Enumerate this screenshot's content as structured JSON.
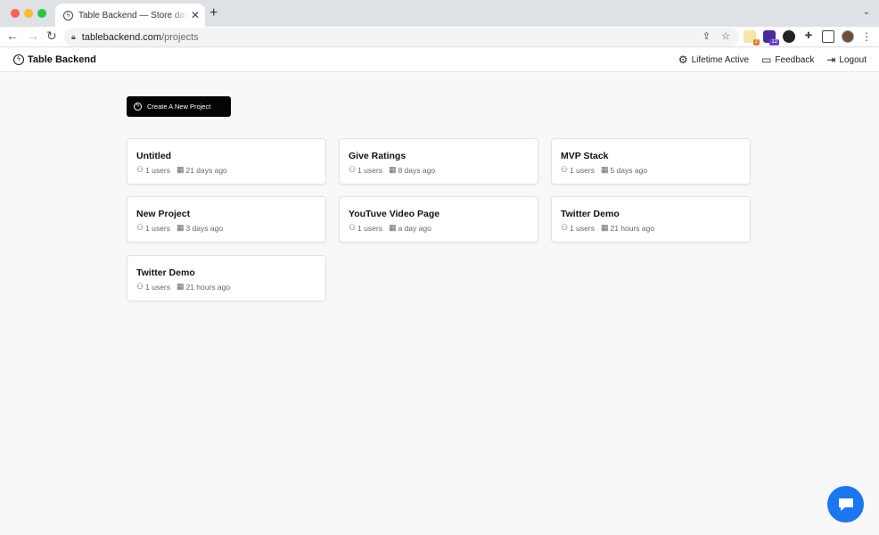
{
  "browser": {
    "tab_title": "Table Backend — Store data in tables",
    "tab_close": "✕",
    "new_tab": "+",
    "url_host": "tablebackend.com",
    "url_path": "/projects"
  },
  "header": {
    "brand": "Table Backend",
    "links": {
      "lifetime": "Lifetime Active",
      "feedback": "Feedback",
      "logout": "Logout"
    }
  },
  "create_button": "Create A New Project",
  "projects": [
    {
      "name": "Untitled",
      "users": "1 users",
      "updated": "21 days ago"
    },
    {
      "name": "Give Ratings",
      "users": "1 users",
      "updated": "8 days ago"
    },
    {
      "name": "MVP Stack",
      "users": "1 users",
      "updated": "5 days ago"
    },
    {
      "name": "New Project",
      "users": "1 users",
      "updated": "3 days ago"
    },
    {
      "name": "YouTuve Video Page",
      "users": "1 users",
      "updated": "a day ago"
    },
    {
      "name": "Twitter Demo",
      "users": "1 users",
      "updated": "21 hours ago"
    },
    {
      "name": "Twitter Demo",
      "users": "1 users",
      "updated": "21 hours ago"
    }
  ],
  "extensions": {
    "badge_1": "2",
    "badge_2": "12"
  },
  "colors": {
    "accent": "#050505",
    "chat": "#1b76f2"
  }
}
